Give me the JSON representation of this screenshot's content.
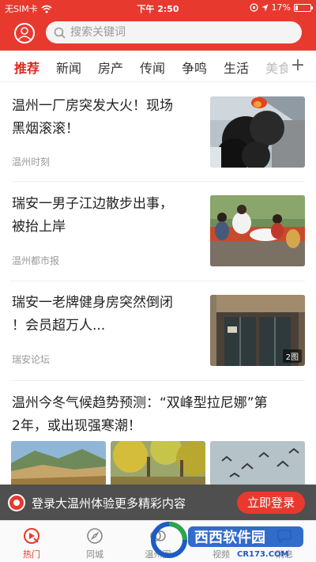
{
  "status_bar": {
    "carrier": "无SIM卡",
    "time": "下午 2:50",
    "battery": "17%",
    "battery_level": 0.17
  },
  "header": {
    "search_placeholder": "搜索关键词",
    "avatar_icon": "user-icon",
    "search_icon": "search-icon"
  },
  "tabs": [
    {
      "label": "推荐",
      "active": true
    },
    {
      "label": "新闻"
    },
    {
      "label": "房产"
    },
    {
      "label": "传闻"
    },
    {
      "label": "争鸣"
    },
    {
      "label": "生活"
    },
    {
      "label": "美食"
    }
  ],
  "tabs_more": "+",
  "news": [
    {
      "title_line1": "温州一厂房突发大火！现场",
      "title_line2": "黑烟滚滚！",
      "source": "温州时刻"
    },
    {
      "title_line1": "瑞安一男子江边散步出事，",
      "title_line2": "被抬上岸",
      "source": "温州都市报"
    },
    {
      "title_line1": "瑞安一老牌健身房突然倒闭",
      "title_line2": "！会员超万人...",
      "source": "瑞安论坛",
      "image_count": "2图"
    },
    {
      "title_line1": "温州今冬气候趋势预测：“双峰型拉尼娜”第",
      "title_line2": "2年，或出现强寒潮！"
    }
  ],
  "login_banner": {
    "text": "登录大温州体验更多精彩内容",
    "button": "立即登录"
  },
  "bottom_nav": [
    {
      "label": "热门",
      "icon": "hot-icon",
      "active": true
    },
    {
      "label": "同城",
      "icon": "compass-icon"
    },
    {
      "label": "温州圈",
      "icon": "circle-icon"
    },
    {
      "label": "视频",
      "icon": "video-icon"
    },
    {
      "label": "消息",
      "icon": "message-icon"
    }
  ],
  "watermark": {
    "brand": "西西软件园",
    "url": "CR173.COM"
  },
  "colors": {
    "brand_red": "#e8392f",
    "active_tab": "#d6291f"
  }
}
